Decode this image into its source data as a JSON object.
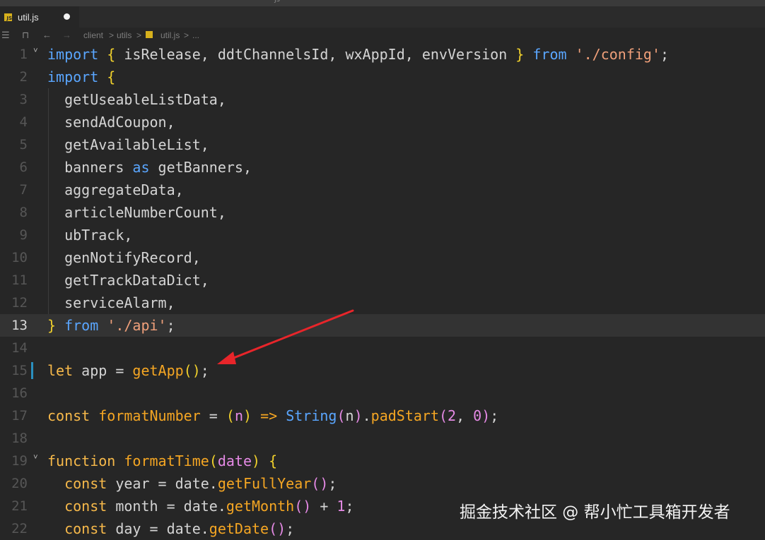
{
  "window": {
    "top_mark": "js"
  },
  "tab": {
    "icon_text": "JS",
    "filename": "util.js"
  },
  "breadcrumb": {
    "items": [
      "client",
      "utils",
      "util.js",
      "..."
    ],
    "separator": ">"
  },
  "editor": {
    "lines": [
      {
        "num": "1",
        "tokens": [
          [
            "kb",
            "import"
          ],
          [
            "pu",
            " "
          ],
          [
            "ye",
            "{"
          ],
          [
            "pu",
            " isRelease, ddtChannelsId, wxAppId, envVersion "
          ],
          [
            "ye",
            "}"
          ],
          [
            "pu",
            " "
          ],
          [
            "kb",
            "from"
          ],
          [
            "pu",
            " "
          ],
          [
            "st",
            "'./config'"
          ],
          [
            "pu",
            ";"
          ]
        ]
      },
      {
        "num": "2",
        "tokens": [
          [
            "kb",
            "import"
          ],
          [
            "pu",
            " "
          ],
          [
            "ye",
            "{"
          ]
        ]
      },
      {
        "num": "3",
        "tokens": [
          [
            "pu",
            "  getUseableListData,"
          ]
        ]
      },
      {
        "num": "4",
        "tokens": [
          [
            "pu",
            "  sendAdCoupon,"
          ]
        ]
      },
      {
        "num": "5",
        "tokens": [
          [
            "pu",
            "  getAvailableList,"
          ]
        ]
      },
      {
        "num": "6",
        "tokens": [
          [
            "pu",
            "  banners "
          ],
          [
            "kb",
            "as"
          ],
          [
            "pu",
            " getBanners,"
          ]
        ]
      },
      {
        "num": "7",
        "tokens": [
          [
            "pu",
            "  aggregateData,"
          ]
        ]
      },
      {
        "num": "8",
        "tokens": [
          [
            "pu",
            "  articleNumberCount,"
          ]
        ]
      },
      {
        "num": "9",
        "tokens": [
          [
            "pu",
            "  ubTrack,"
          ]
        ]
      },
      {
        "num": "10",
        "tokens": [
          [
            "pu",
            "  genNotifyRecord,"
          ]
        ]
      },
      {
        "num": "11",
        "tokens": [
          [
            "pu",
            "  getTrackDataDict,"
          ]
        ]
      },
      {
        "num": "12",
        "tokens": [
          [
            "pu",
            "  serviceAlarm,"
          ]
        ]
      },
      {
        "num": "13",
        "tokens": [
          [
            "ye",
            "}"
          ],
          [
            "pu",
            " "
          ],
          [
            "kb",
            "from"
          ],
          [
            "pu",
            " "
          ],
          [
            "st",
            "'./api'"
          ],
          [
            "pu",
            ";"
          ]
        ]
      },
      {
        "num": "14",
        "tokens": []
      },
      {
        "num": "15",
        "tokens": [
          [
            "kw",
            "let"
          ],
          [
            "pu",
            " app = "
          ],
          [
            "fn",
            "getApp"
          ],
          [
            "ye",
            "()"
          ],
          [
            "pu",
            ";"
          ]
        ]
      },
      {
        "num": "16",
        "tokens": []
      },
      {
        "num": "17",
        "tokens": [
          [
            "kw",
            "const"
          ],
          [
            "pu",
            " "
          ],
          [
            "fn",
            "formatNumber"
          ],
          [
            "pu",
            " = "
          ],
          [
            "ye",
            "("
          ],
          [
            "pa",
            "n"
          ],
          [
            "ye",
            ")"
          ],
          [
            "pu",
            " "
          ],
          [
            "ar",
            "=>"
          ],
          [
            "pu",
            " "
          ],
          [
            "cl",
            "String"
          ],
          [
            "pa",
            "("
          ],
          [
            "pu",
            "n"
          ],
          [
            "pa",
            ")"
          ],
          [
            "pu",
            "."
          ],
          [
            "fn",
            "padStart"
          ],
          [
            "pa",
            "("
          ],
          [
            "nu",
            "2"
          ],
          [
            "pu",
            ", "
          ],
          [
            "nu",
            "0"
          ],
          [
            "pa",
            ")"
          ],
          [
            "pu",
            ";"
          ]
        ]
      },
      {
        "num": "18",
        "tokens": []
      },
      {
        "num": "19",
        "tokens": [
          [
            "kw",
            "function"
          ],
          [
            "pu",
            " "
          ],
          [
            "fn",
            "formatTime"
          ],
          [
            "ye",
            "("
          ],
          [
            "pa",
            "date"
          ],
          [
            "ye",
            ")"
          ],
          [
            "pu",
            " "
          ],
          [
            "ye",
            "{"
          ]
        ]
      },
      {
        "num": "20",
        "tokens": [
          [
            "kw",
            "  const"
          ],
          [
            "pu",
            " year = date."
          ],
          [
            "fn",
            "getFullYear"
          ],
          [
            "pa",
            "()"
          ],
          [
            "pu",
            ";"
          ]
        ]
      },
      {
        "num": "21",
        "tokens": [
          [
            "kw",
            "  const"
          ],
          [
            "pu",
            " month = date."
          ],
          [
            "fn",
            "getMonth"
          ],
          [
            "pa",
            "()"
          ],
          [
            "pu",
            " + "
          ],
          [
            "nu",
            "1"
          ],
          [
            "pu",
            ";"
          ]
        ]
      },
      {
        "num": "22",
        "tokens": [
          [
            "kw",
            "  const"
          ],
          [
            "pu",
            " day = date."
          ],
          [
            "fn",
            "getDate"
          ],
          [
            "pa",
            "()"
          ],
          [
            "pu",
            ";"
          ]
        ]
      }
    ],
    "active_line": "13",
    "fold_lines": [
      "1",
      "19"
    ],
    "modified_line": "15",
    "guide_lines": [
      "3",
      "4",
      "5",
      "6",
      "7",
      "8",
      "9",
      "10",
      "11",
      "12"
    ]
  },
  "annotation": {
    "color": "#e8252a",
    "points_to": "15"
  },
  "watermark": {
    "text": "掘金技术社区 @ 帮小忙工具箱开发者"
  }
}
